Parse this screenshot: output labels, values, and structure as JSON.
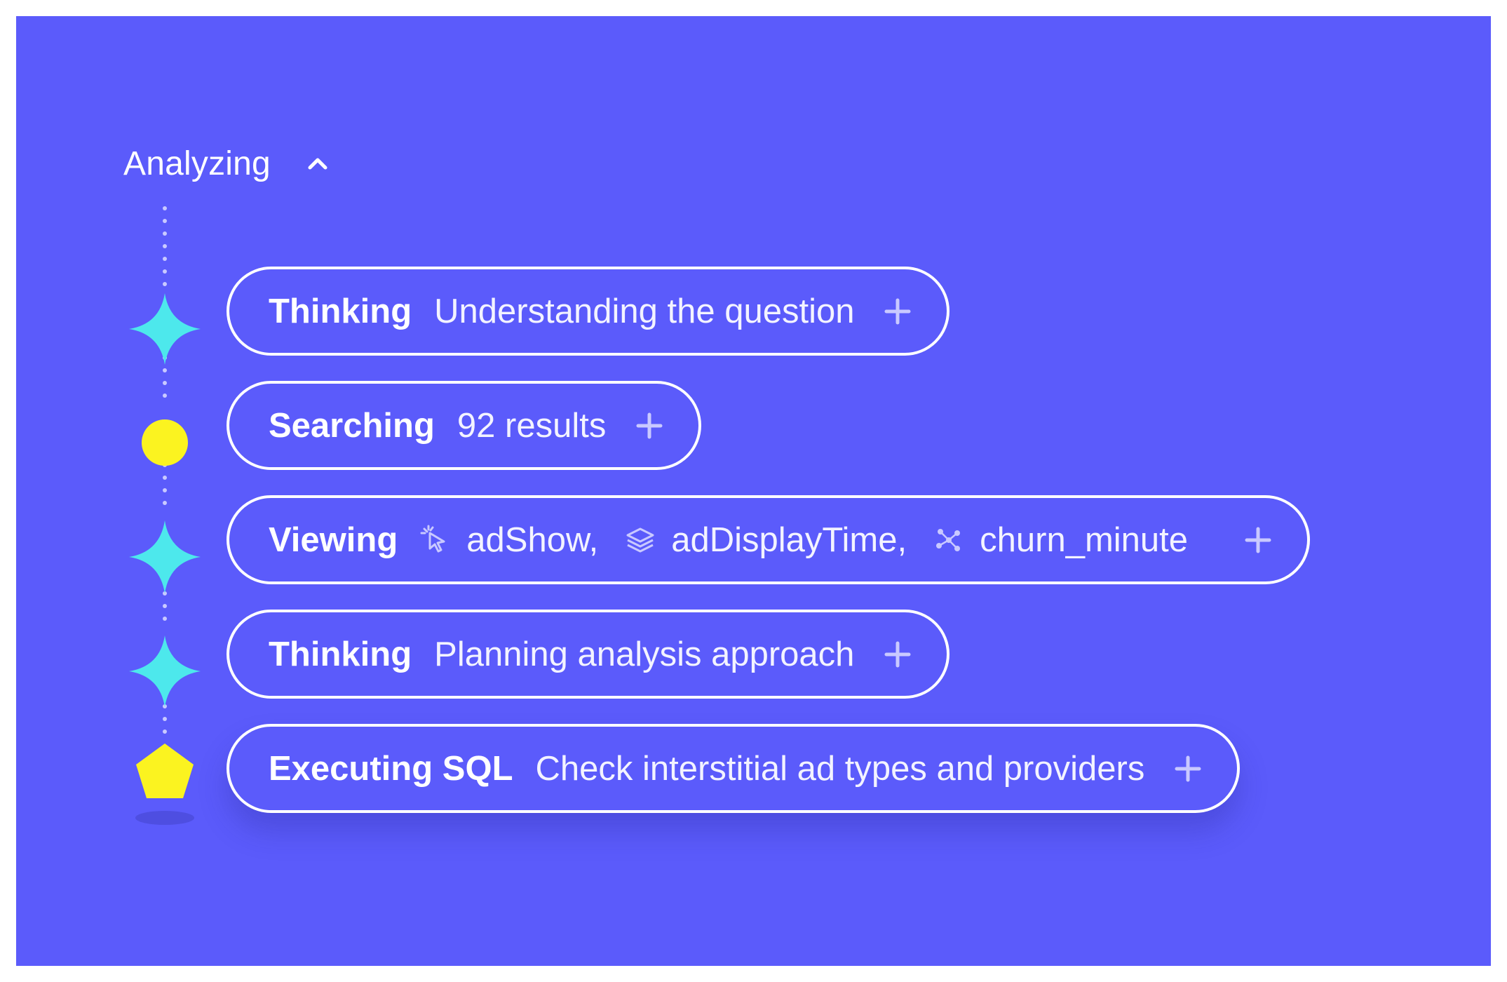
{
  "header": {
    "label": "Analyzing",
    "chevron_icon": "chevron-up-icon"
  },
  "steps": [
    {
      "marker": "sparkle-cyan",
      "title": "Thinking",
      "text": "Understanding the question",
      "action_icon": "plus-icon"
    },
    {
      "marker": "circle-yellow",
      "title": "Searching",
      "text": "92 results",
      "action_icon": "plus-icon"
    },
    {
      "marker": "sparkle-cyan",
      "title": "Viewing",
      "chips": [
        {
          "icon": "cursor-click-icon",
          "label": "adShow,"
        },
        {
          "icon": "layers-icon",
          "label": "adDisplayTime,"
        },
        {
          "icon": "network-nodes-icon",
          "label": "churn_minute"
        }
      ],
      "action_icon": "plus-icon"
    },
    {
      "marker": "sparkle-cyan",
      "title": "Thinking",
      "text": "Planning analysis approach",
      "action_icon": "plus-icon"
    },
    {
      "marker": "pentagon-yellow",
      "title": "Executing SQL",
      "text": "Check interstitial ad types and providers",
      "action_icon": "plus-icon"
    }
  ],
  "colors": {
    "background": "#5b5bfb",
    "sparkle": "#4de8ec",
    "yellow": "#fbf320",
    "outline": "#ffffff",
    "dots": "#c9c9ff"
  }
}
